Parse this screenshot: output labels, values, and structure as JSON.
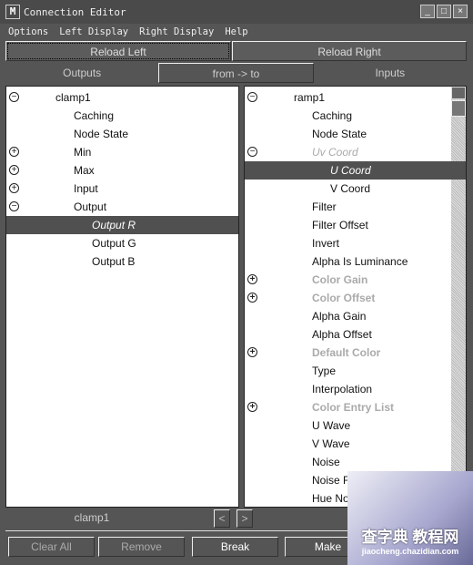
{
  "window": {
    "title": "Connection Editor",
    "logo": "M",
    "controls": [
      "minimize-icon",
      "maximize-icon",
      "close-icon"
    ]
  },
  "menu": [
    "Options",
    "Left Display",
    "Right Display",
    "Help"
  ],
  "reload": {
    "left": "Reload Left",
    "right": "Reload Right"
  },
  "tabs": [
    "Outputs",
    "from -> to",
    "Inputs"
  ],
  "left": {
    "rows": [
      {
        "label": "clamp1",
        "level": 0,
        "expander": "collapse"
      },
      {
        "label": "Caching",
        "level": 1
      },
      {
        "label": "Node State",
        "level": 1
      },
      {
        "label": "Min",
        "level": 1,
        "expander": "expand"
      },
      {
        "label": "Max",
        "level": 1,
        "expander": "expand"
      },
      {
        "label": "Input",
        "level": 1,
        "expander": "expand"
      },
      {
        "label": "Output",
        "level": 1,
        "expander": "collapse"
      },
      {
        "label": "Output R",
        "level": 2,
        "state": "selected"
      },
      {
        "label": "Output G",
        "level": 2
      },
      {
        "label": "Output B",
        "level": 2
      }
    ]
  },
  "right": {
    "rows": [
      {
        "label": "ramp1",
        "level": 0,
        "expander": "collapse"
      },
      {
        "label": "Caching",
        "level": 1
      },
      {
        "label": "Node State",
        "level": 1
      },
      {
        "label": "Uv Coord",
        "level": 1,
        "expander": "collapse",
        "state": "dim-italic"
      },
      {
        "label": "U Coord",
        "level": 2,
        "state": "selected"
      },
      {
        "label": "V Coord",
        "level": 2
      },
      {
        "label": "Filter",
        "level": 1
      },
      {
        "label": "Filter Offset",
        "level": 1
      },
      {
        "label": "Invert",
        "level": 1
      },
      {
        "label": "Alpha Is Luminance",
        "level": 1
      },
      {
        "label": "Color Gain",
        "level": 1,
        "expander": "expand",
        "state": "dim"
      },
      {
        "label": "Color Offset",
        "level": 1,
        "expander": "expand",
        "state": "dim"
      },
      {
        "label": "Alpha Gain",
        "level": 1
      },
      {
        "label": "Alpha Offset",
        "level": 1
      },
      {
        "label": "Default Color",
        "level": 1,
        "expander": "expand",
        "state": "dim"
      },
      {
        "label": "Type",
        "level": 1
      },
      {
        "label": "Interpolation",
        "level": 1
      },
      {
        "label": "Color Entry List",
        "level": 1,
        "expander": "expand",
        "state": "dim"
      },
      {
        "label": "U Wave",
        "level": 1
      },
      {
        "label": "V Wave",
        "level": 1
      },
      {
        "label": "Noise",
        "level": 1
      },
      {
        "label": "Noise Freq",
        "level": 1
      },
      {
        "label": "Hue Noise",
        "level": 1
      }
    ]
  },
  "footer": {
    "left_node": "clamp1",
    "prev": "<",
    "next": ">",
    "buttons": [
      "Clear All",
      "Remove",
      "Break",
      "Make"
    ]
  },
  "watermark": {
    "line1": "查字典 教程网",
    "line2": "jiaocheng.chazidian.com"
  }
}
